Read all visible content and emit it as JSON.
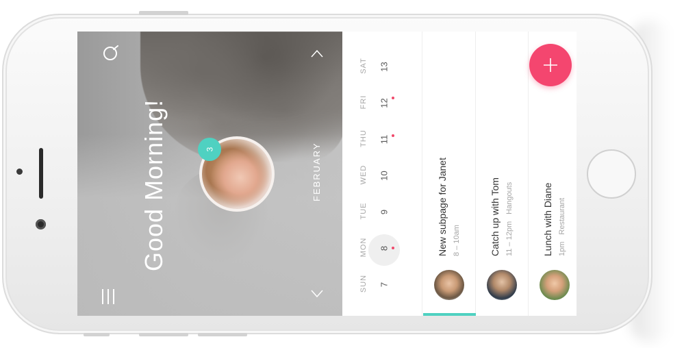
{
  "hero": {
    "greeting": "Good Morning!",
    "month": "FEBRUARY",
    "notification_count": "3"
  },
  "calendar": {
    "days": [
      {
        "dow": "SUN",
        "num": "7",
        "dot": false,
        "today": false
      },
      {
        "dow": "MON",
        "num": "8",
        "dot": true,
        "today": true
      },
      {
        "dow": "TUE",
        "num": "9",
        "dot": false,
        "today": false
      },
      {
        "dow": "WED",
        "num": "10",
        "dot": false,
        "today": false
      },
      {
        "dow": "THU",
        "num": "11",
        "dot": true,
        "today": false
      },
      {
        "dow": "FRI",
        "num": "12",
        "dot": true,
        "today": false
      },
      {
        "dow": "SAT",
        "num": "13",
        "dot": false,
        "today": false
      }
    ]
  },
  "events": [
    {
      "title": "New subpage for Janet",
      "time": "8 – 10am",
      "location": ""
    },
    {
      "title": "Catch up with Tom",
      "time": "11 – 12pm",
      "location": "Hangouts"
    },
    {
      "title": "Lunch with Diane",
      "time": "1pm",
      "location": "Restaurant"
    }
  ],
  "icons": {
    "search": "search-icon",
    "menu": "menu-icon",
    "up": "chevron-up-icon",
    "down": "chevron-down-icon",
    "add": "plus-icon"
  },
  "colors": {
    "accent": "#4fd1c1",
    "fab": "#f4466f",
    "dot": "#f0496b"
  }
}
